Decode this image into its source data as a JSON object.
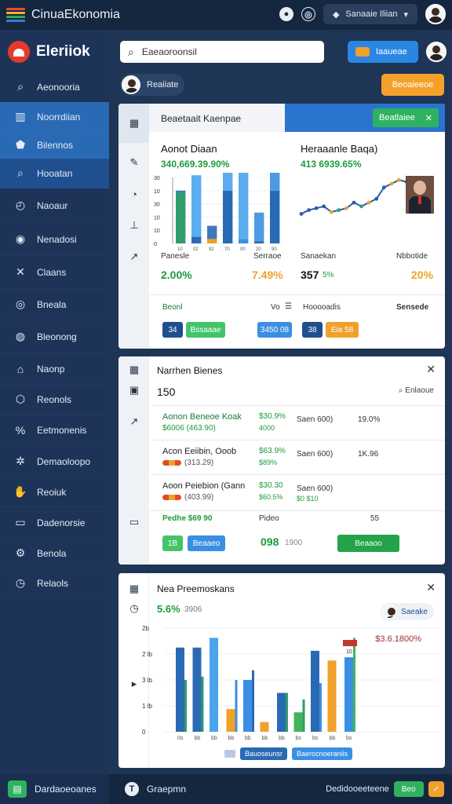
{
  "topbar": {
    "app_title": "СinuaEkonomia",
    "pill_label": "Sanaaie Iliian"
  },
  "sidebar": {
    "brand": "Eleriiok",
    "items": [
      {
        "label": "Aeonooria",
        "icon": "search-icon",
        "state": ""
      },
      {
        "label": "Noorrdiian",
        "icon": "chart-icon",
        "state": "active"
      },
      {
        "label": "Bilennos",
        "icon": "tag-icon",
        "state": "active"
      },
      {
        "label": "Hooatan",
        "icon": "search-icon",
        "state": "hl"
      },
      {
        "label": "Naoaur",
        "icon": "dial-icon",
        "state": ""
      },
      {
        "label": "Nenadosi",
        "icon": "coin-icon",
        "state": ""
      },
      {
        "label": "Claans",
        "icon": "tools-icon",
        "state": ""
      },
      {
        "label": "Bneala",
        "icon": "target-icon",
        "state": ""
      },
      {
        "label": "Bleonong",
        "icon": "globe-icon",
        "state": ""
      },
      {
        "label": "Naonp",
        "icon": "house-icon",
        "state": ""
      },
      {
        "label": "Reonols",
        "icon": "shield-icon",
        "state": ""
      },
      {
        "label": "Eetmonenis",
        "icon": "percent-icon",
        "state": ""
      },
      {
        "label": "Demaoloopo",
        "icon": "settings-icon",
        "state": ""
      },
      {
        "label": "Reoiuk",
        "icon": "hand-icon",
        "state": ""
      },
      {
        "label": "Dadenorsie",
        "icon": "monitor-icon",
        "state": ""
      },
      {
        "label": "Benola",
        "icon": "gear-icon",
        "state": ""
      },
      {
        "label": "Relaols",
        "icon": "clock-icon",
        "state": ""
      }
    ],
    "bottom_label": "Dardaoeoanes"
  },
  "header": {
    "search_value": "Eaeaoroonsil",
    "blue_button": "Iaaueae",
    "user_name": "Reaiiate",
    "orange_button": "Beoaieeoe"
  },
  "panel1": {
    "head_title": "Beaetaait Kaenpae",
    "head_button": "Beatlaiee",
    "left_card": {
      "title": "Aonot Diaan",
      "big_value": "340,669.39.90%",
      "y_ticks": [
        "30",
        "10",
        "30",
        "10",
        "10",
        "0"
      ],
      "x_ticks": [
        "10",
        "02",
        "92",
        "70",
        "00",
        "20",
        "90"
      ],
      "sub_left": "Panesle",
      "sub_right": "Serraoe",
      "kpi_left": "2.00%",
      "kpi_right": "7.49%",
      "footer_left": "Beonl",
      "footer_right": "Vo",
      "pill_a": "34",
      "pill_b": "Bssaaae",
      "pill_c": "3450 08"
    },
    "right_card": {
      "title": "Heraaanle Baqa)",
      "big_value": "413 6939.65%",
      "sub_left": "Sanaekan",
      "sub_right": "Nbbotide",
      "kpi_left": "357",
      "kpi_left_small": "5%",
      "kpi_right": "20%",
      "footer_left": "Hooooadis",
      "footer_right": "Sensede",
      "pill_a": "38",
      "pill_b": "Eia 58"
    }
  },
  "panel2": {
    "title": "Narrhen Bienes",
    "count": "150",
    "search_placeholder": "Enlaoue",
    "rows": [
      {
        "name": "Aonon Beneoe Koak",
        "sub": "$6006 (463.90)",
        "c2": "$30.9%",
        "c2s": "4000",
        "c3": "Saen 600)",
        "c3s": "",
        "c4": "19.0%",
        "tone": "green"
      },
      {
        "name": "Acon Eeiibin, Ooob",
        "sub": "(313.29)",
        "c2": "$63.9%",
        "c2s": "$89%",
        "c3": "Saen 600)",
        "c3s": "",
        "c4": "1K.96",
        "tone": "dark"
      },
      {
        "name": "Aoon Peiebion (Gann",
        "sub": "(403.99)",
        "c2": "$30.30",
        "c2s": "$60.5%",
        "c3": "Saen 600)",
        "c3s": "$0  $10",
        "c4": "",
        "tone": "dark"
      }
    ],
    "sum_label": "Pedhe  $69 90",
    "sum_mid": "Pideo",
    "sum_right": "55",
    "foot_pill_a": "1B",
    "foot_pill_b": "Beaaeo",
    "foot_big": "098",
    "foot_small": "1900",
    "foot_button": "Beaaoo"
  },
  "panel3": {
    "title": "Nea Preemoskans",
    "kpi": "5.6%",
    "kpi_small": "3906",
    "chip_label": "Saeake",
    "note": "$3.6.1800%",
    "flag": "10",
    "legend_a": "Bauoseunsr",
    "legend_b": "Baerocnoeraniis"
  },
  "bottombar": {
    "center_label": "Graepmn",
    "right_label": "Dedidooeeteene",
    "right_btn": "Beo"
  },
  "chart_data": [
    {
      "type": "bar",
      "title": "Aonot Diaan",
      "categories": [
        "10",
        "02",
        "92",
        "70",
        "00",
        "20",
        "90"
      ],
      "series": [
        {
          "values": [
            23,
            3,
            2,
            24,
            2,
            1,
            24
          ]
        },
        {
          "values": [
            1,
            28,
            6,
            24,
            34,
            13,
            30
          ]
        }
      ],
      "ylim": [
        0,
        30
      ]
    },
    {
      "type": "line",
      "title": "Heraaanle Baqa)",
      "values": [
        34,
        36,
        37,
        38,
        35,
        36,
        37,
        40,
        38,
        40,
        42,
        48,
        50,
        52,
        51
      ]
    },
    {
      "type": "bar",
      "title": "Nea Preemoskans",
      "y_ticks": [
        "2b",
        "2 lb",
        "3 lb",
        "1 lb",
        "0"
      ],
      "series": [
        {
          "values": [
            2.6,
            2.6,
            2.9,
            0.7,
            1.6,
            0.3,
            1.2,
            0.6,
            2.5,
            2.2,
            2.3
          ]
        },
        {
          "values": [
            1.6,
            1.7,
            0,
            1.6,
            1.9,
            0,
            1.2,
            1.0,
            1.5,
            0,
            2.9
          ]
        }
      ]
    }
  ]
}
